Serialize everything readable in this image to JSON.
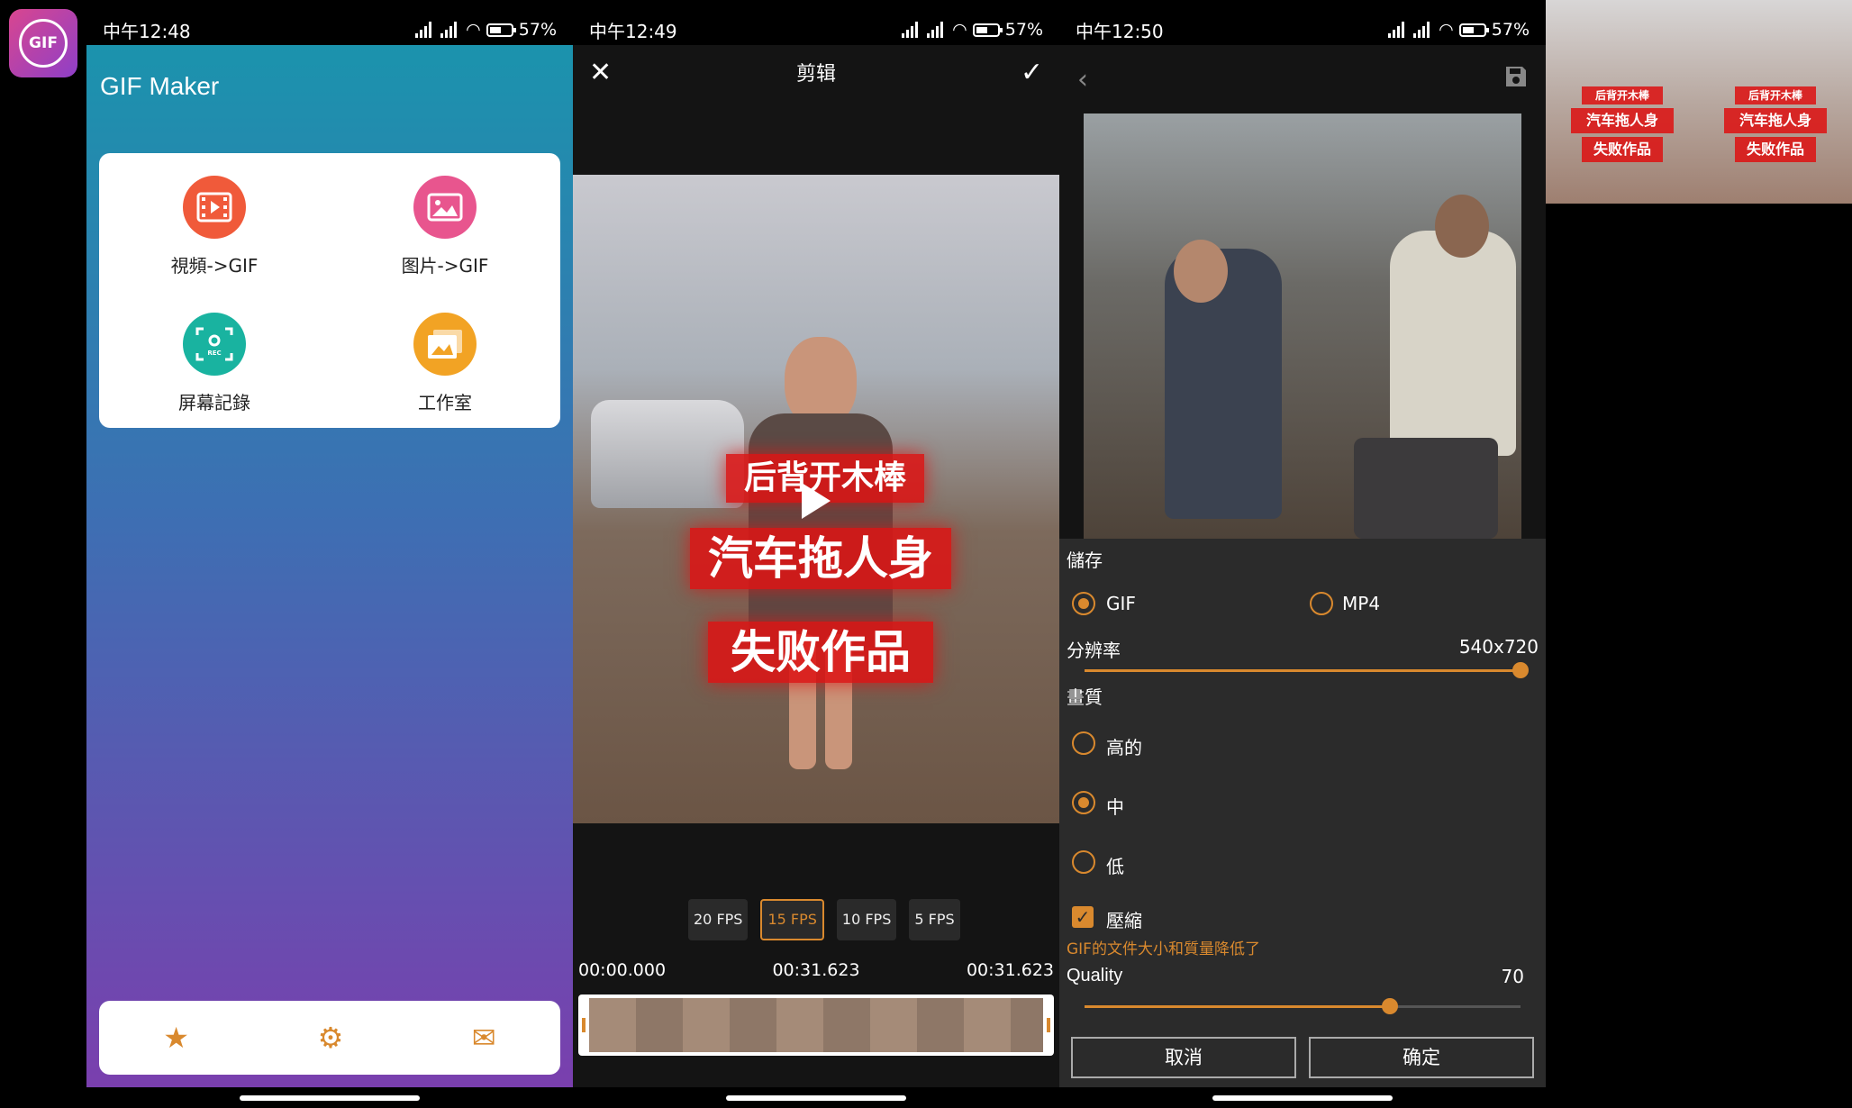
{
  "app_icon": {
    "label": "GIF"
  },
  "panel1": {
    "status": {
      "time": "中午12:48",
      "battery": "57%"
    },
    "title": "GIF Maker",
    "tiles": [
      {
        "label": "視頻->GIF",
        "icon": "film-icon",
        "color": "#f05a3a"
      },
      {
        "label": "图片->GIF",
        "icon": "image-icon",
        "color": "#e8558e"
      },
      {
        "label": "屏幕記錄",
        "icon": "record-icon",
        "color": "#19b3a0"
      },
      {
        "label": "工作室",
        "icon": "gallery-icon",
        "color": "#f2a324"
      }
    ],
    "bottom_nav": [
      "star-icon",
      "gear-icon",
      "mail-icon"
    ]
  },
  "panel2": {
    "status": {
      "time": "中午12:49",
      "battery": "57%"
    },
    "title": "剪辑",
    "video_captions": [
      "后背开木棒",
      "汽车拖人身",
      "失败作品"
    ],
    "fps_options": [
      "20 FPS",
      "15 FPS",
      "10 FPS",
      "5 FPS"
    ],
    "fps_selected": "15 FPS",
    "time_start": "00:00.000",
    "time_mid": "00:31.623",
    "time_end": "00:31.623"
  },
  "panel3": {
    "status": {
      "time": "中午12:50",
      "battery": "57%"
    },
    "save_section": "儲存",
    "format_gif": "GIF",
    "format_mp4": "MP4",
    "format_selected": "GIF",
    "resolution_label": "分辨率",
    "resolution_value": "540x720",
    "resolution_level": 1.0,
    "quality_section": "畫質",
    "quality_high": "高的",
    "quality_mid": "中",
    "quality_low": "低",
    "quality_selected": "中",
    "compress_label": "壓縮",
    "compress_checked": true,
    "compress_note": "GIF的文件大小和質量降低了",
    "quality_label": "Quality",
    "quality_value": "70",
    "quality_level": 0.7,
    "cancel_label": "取消",
    "confirm_label": "确定"
  },
  "thumbs": {
    "captions": [
      "后背开木棒",
      "汽车拖人身",
      "失败作品"
    ]
  },
  "colors": {
    "accent": "#d9892e",
    "dark_bg": "#141414",
    "settings_bg": "#2b2b2b"
  }
}
